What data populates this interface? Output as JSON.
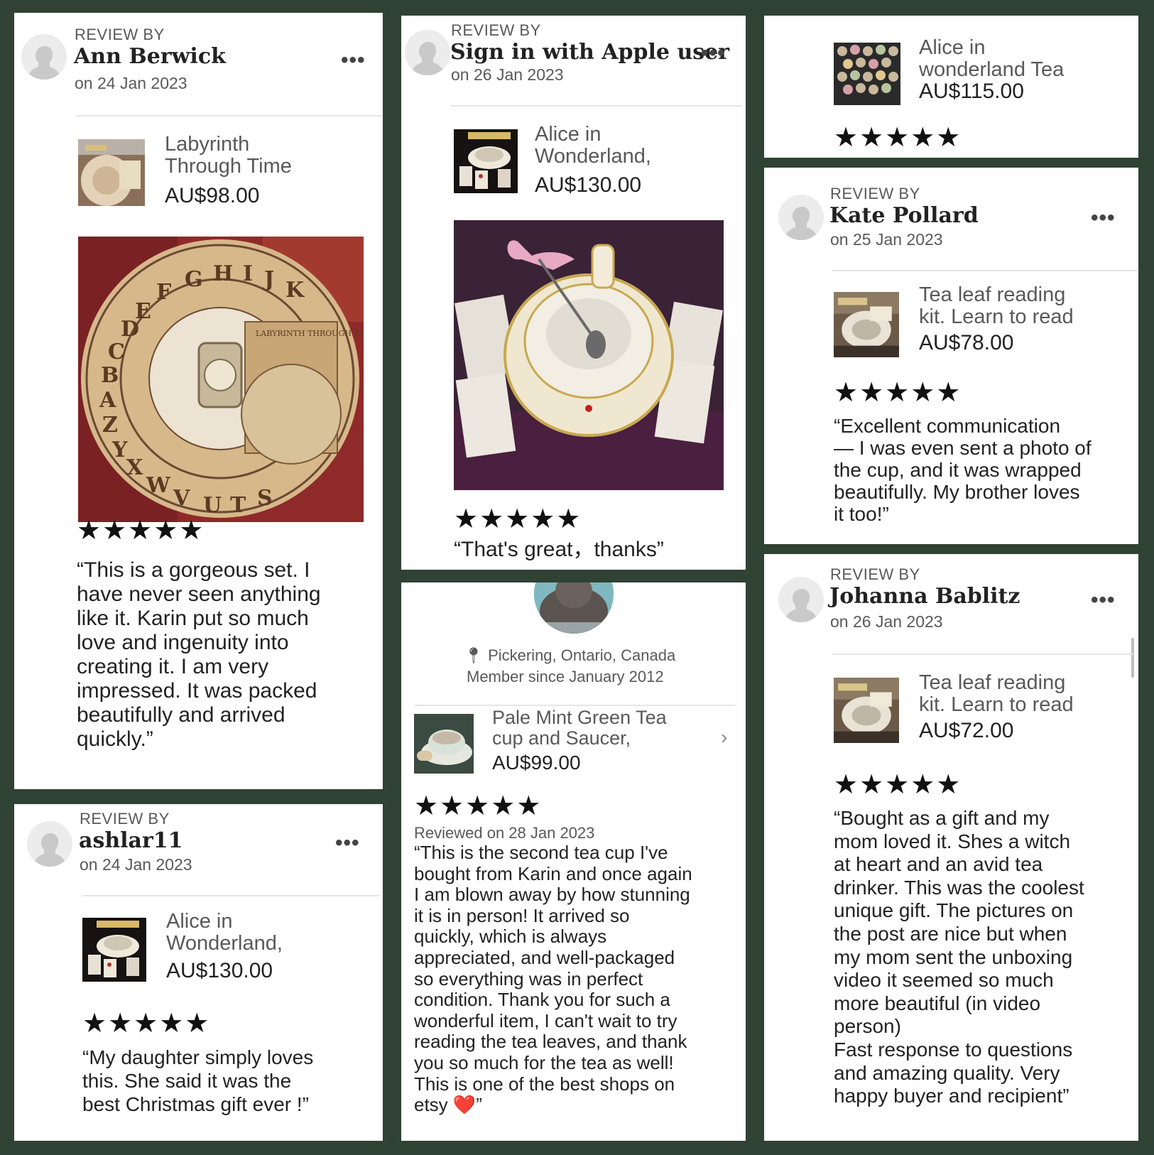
{
  "review_by_label": "REVIEW BY",
  "more_label": "•••",
  "stars": "★★★★★",
  "cards": {
    "ann": {
      "name": "Ann Berwick",
      "date": "on 24 Jan 2023",
      "product_title": "Labyrinth\nThrough Time",
      "price": "AU$98.00",
      "text": "“This is a gorgeous set. I\nhave never seen anything\nlike it. Karin put so much\nlove and ingenuity into\ncreating it. I am very\nimpressed. It was packed\nbeautifully and arrived\nquickly.”"
    },
    "apple": {
      "name": "Sign in with Apple user",
      "date": "on 26 Jan 2023",
      "product_title": "Alice in\nWonderland,",
      "price": "AU$130.00",
      "text": "“That's great，thanks”"
    },
    "alice_top": {
      "product_title": "Alice in\nwonderland Tea",
      "price": "AU$115.00"
    },
    "kate": {
      "name": "Kate Pollard",
      "date": "on 25 Jan 2023",
      "product_title": "Tea leaf reading\nkit. Learn to read",
      "price": "AU$78.00",
      "text": "“Excellent communication\n— I was even sent a photo of\nthe cup, and it was wrapped\nbeautifully. My brother loves\nit too!”"
    },
    "ashlar": {
      "name": "ashlar11",
      "date": "on 24 Jan 2023",
      "product_title": "Alice in\nWonderland,",
      "price": "AU$130.00",
      "text": "“My daughter simply loves\nthis.  She said it was the\nbest Christmas gift ever !”"
    },
    "pickering": {
      "location": "Pickering, Ontario, Canada",
      "member_since": "Member since January 2012",
      "product_title": "Pale Mint Green Tea\ncup and Saucer,",
      "price": "AU$99.00",
      "reviewed_on": "Reviewed on 28 Jan 2023",
      "text": "“This is the second tea cup I've\nbought from Karin and once again\nI am blown away by how stunning\nit is in person! It arrived so\nquickly, which is always\nappreciated, and well-packaged\nso everything was in perfect\ncondition. Thank you for such a\nwonderful item, I can't wait to try\nreading the tea leaves, and thank\nyou so much for the tea as well!\nThis is one of the best shops on\netsy ❤️”"
    },
    "johanna": {
      "name": "Johanna Bablitz",
      "date": "on 26 Jan 2023",
      "product_title": "Tea leaf reading\nkit. Learn to read",
      "price": "AU$72.00",
      "text": "“Bought as a gift and my\nmom loved it. Shes a witch\nat heart and an avid tea\ndrinker. This was the coolest\nunique gift. The pictures on\nthe post are nice but when\nmy mom sent the unboxing\nvideo it seemed so much\nmore beautiful (in video\nperson)\nFast response to questions\nand amazing quality. Very\nhappy buyer and recipient”"
    }
  },
  "icons": {
    "location": "pin-icon",
    "chevron": "chevron-right-icon",
    "more": "more-dots-icon"
  },
  "colors": {
    "background": "#2f4234",
    "card": "#ffffff",
    "text": "#222222",
    "muted": "#595959"
  }
}
